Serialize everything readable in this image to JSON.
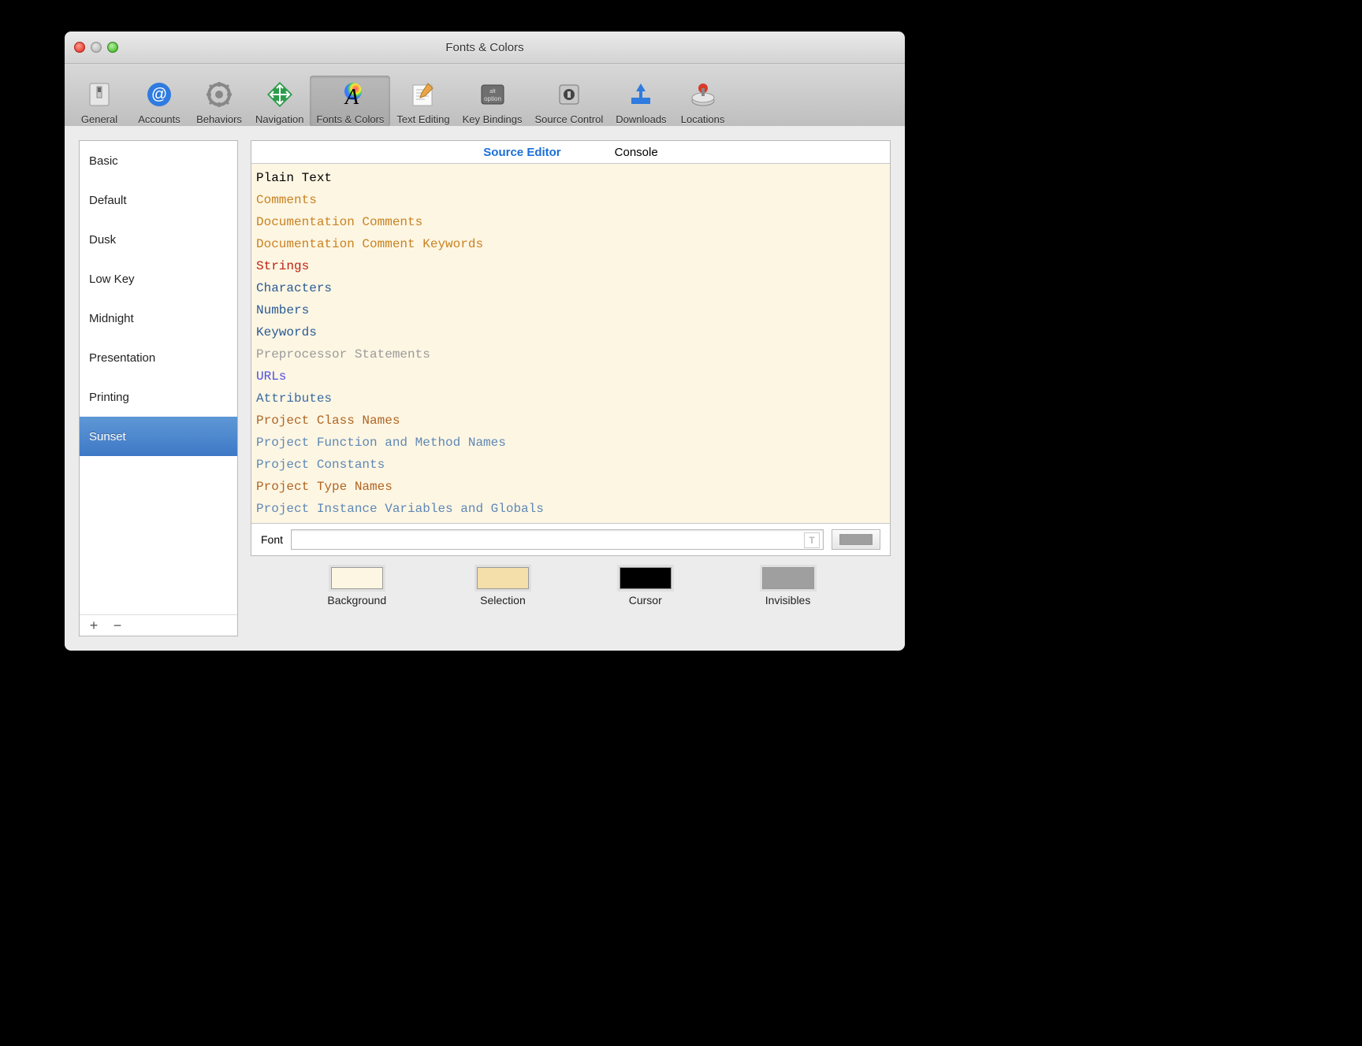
{
  "window_title": "Fonts & Colors",
  "toolbar": [
    {
      "label": "General"
    },
    {
      "label": "Accounts"
    },
    {
      "label": "Behaviors"
    },
    {
      "label": "Navigation"
    },
    {
      "label": "Fonts & Colors",
      "selected": true
    },
    {
      "label": "Text Editing"
    },
    {
      "label": "Key Bindings"
    },
    {
      "label": "Source Control"
    },
    {
      "label": "Downloads"
    },
    {
      "label": "Locations"
    }
  ],
  "themes": [
    {
      "name": "Basic"
    },
    {
      "name": "Default"
    },
    {
      "name": "Dusk"
    },
    {
      "name": "Low Key"
    },
    {
      "name": "Midnight"
    },
    {
      "name": "Presentation"
    },
    {
      "name": "Printing"
    },
    {
      "name": "Sunset",
      "selected": true
    }
  ],
  "tabs": {
    "source_editor": "Source Editor",
    "console": "Console"
  },
  "categories": [
    {
      "name": "Plain Text",
      "color": "#000000"
    },
    {
      "name": "Comments",
      "color": "#c98222"
    },
    {
      "name": "Documentation Comments",
      "color": "#c98222"
    },
    {
      "name": "Documentation Comment Keywords",
      "color": "#c98222"
    },
    {
      "name": "Strings",
      "color": "#c02010"
    },
    {
      "name": "Characters",
      "color": "#2a5a95"
    },
    {
      "name": "Numbers",
      "color": "#2a5a95"
    },
    {
      "name": "Keywords",
      "color": "#2a5a95"
    },
    {
      "name": "Preprocessor Statements",
      "color": "#9a9a9a"
    },
    {
      "name": "URLs",
      "color": "#4d4de5"
    },
    {
      "name": "Attributes",
      "color": "#3a6aa0"
    },
    {
      "name": "Project Class Names",
      "color": "#b06524"
    },
    {
      "name": "Project Function and Method Names",
      "color": "#5e88b5"
    },
    {
      "name": "Project Constants",
      "color": "#5e88b5"
    },
    {
      "name": "Project Type Names",
      "color": "#b06524"
    },
    {
      "name": "Project Instance Variables and Globals",
      "color": "#5e88b5"
    }
  ],
  "font_label": "Font",
  "font_value": "",
  "swatches": {
    "background": {
      "label": "Background",
      "color": "#fdf6e3"
    },
    "selection": {
      "label": "Selection",
      "color": "#f4dea9"
    },
    "cursor": {
      "label": "Cursor",
      "color": "#000000"
    },
    "invisibles": {
      "label": "Invisibles",
      "color": "#9f9f9f"
    }
  },
  "font_well_color": "#9f9f9f"
}
